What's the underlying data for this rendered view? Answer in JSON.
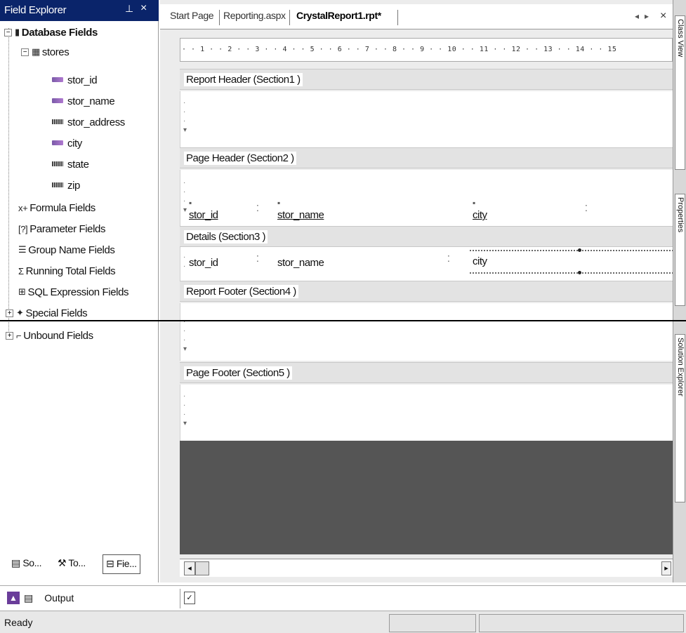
{
  "field_explorer": {
    "title": "Field Explorer",
    "pin_icon": "pin-icon",
    "close_label": "×",
    "tree": {
      "database_fields": "Database Fields",
      "table": "stores",
      "fields": [
        "stor_id",
        "stor_name",
        "stor_address",
        "city",
        "state",
        "zip"
      ],
      "formula_fields": "Formula Fields",
      "parameter_fields": "Parameter Fields",
      "group_name_fields": "Group Name Fields",
      "running_total_fields": "Running Total Fields",
      "sql_expression_fields": "SQL Expression Fields",
      "special_fields": "Special Fields",
      "unbound_fields": "Unbound Fields"
    },
    "bottom_tabs": [
      "So...",
      "To...",
      "Fie..."
    ]
  },
  "document": {
    "tabs": [
      "Start Page",
      "Reporting.aspx",
      "CrystalReport1.rpt*"
    ],
    "active_tab": "CrystalReport1.rpt*",
    "nav_left": "◂",
    "nav_right": "▸",
    "close_label": "×",
    "ruler_text": "· · 1 · · 2 · · 3 · · 4 · · 5 · · 6 · · 7 · · 8 · · 9 · · 10 · · 11 · · 12 · · 13 · · 14 · · 15",
    "sections": {
      "report_header": "Report Header  (Section1 )",
      "page_header": "Page Header  (Section2 )",
      "details": "Details  (Section3 )",
      "report_footer": "Report Footer  (Section4 )",
      "page_footer": "Page Footer  (Section5 )"
    },
    "page_header_fields": [
      "stor_id",
      "stor_name",
      "city"
    ],
    "detail_fields": [
      "stor_id",
      "stor_name",
      "city"
    ]
  },
  "right_panels": {
    "top": "Class View",
    "middle": "Properties",
    "bottom": "Solution Explorer"
  },
  "output": {
    "label": "Output"
  },
  "status": {
    "text": "Ready"
  }
}
